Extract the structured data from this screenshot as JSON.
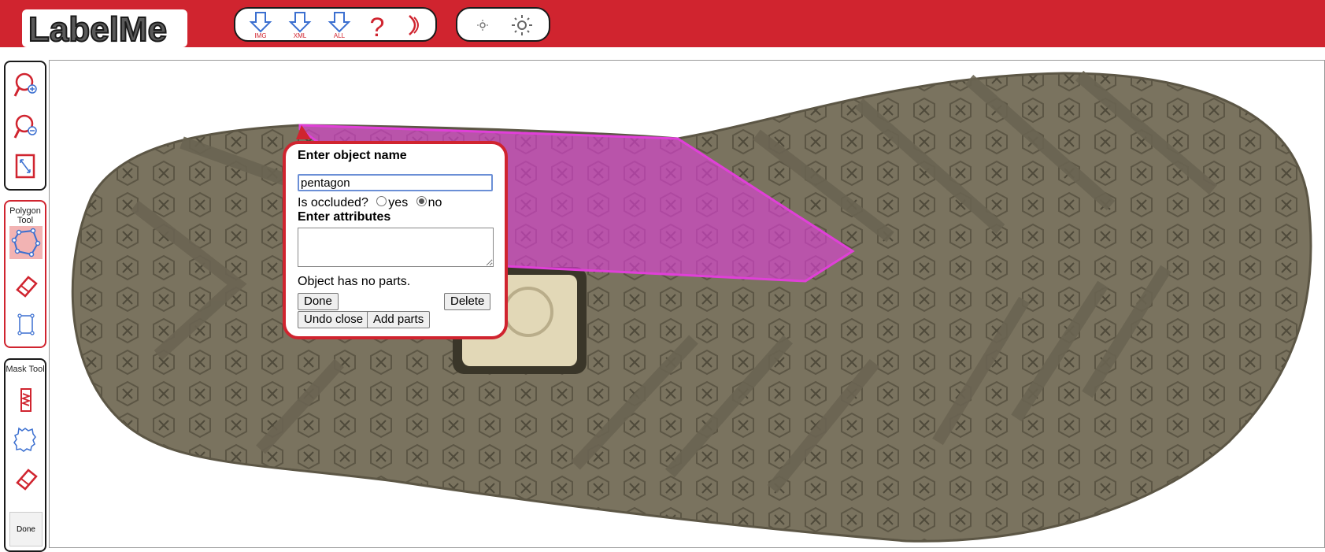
{
  "header": {
    "logo_text": "LabelMe",
    "toolbar": [
      {
        "icon": "download-image-icon",
        "label": "IMG"
      },
      {
        "icon": "download-xml-icon",
        "label": "XML"
      },
      {
        "icon": "download-all-icon",
        "label": "ALL"
      },
      {
        "icon": "help-icon",
        "label": "?"
      },
      {
        "icon": "moon-icon",
        "label": ""
      }
    ],
    "brightness": [
      {
        "icon": "brightness-low-icon"
      },
      {
        "icon": "brightness-high-icon"
      }
    ]
  },
  "sidebar": {
    "zoom": [
      "zoom-in-icon",
      "zoom-out-icon",
      "fit-to-screen-icon"
    ],
    "polygon_tool": {
      "title": "Polygon Tool"
    },
    "mask_tool": {
      "title": "Mask Tool",
      "done_label": "Done"
    }
  },
  "popup": {
    "title": "Enter object name",
    "name_value": "pentagon",
    "occluded_label": "Is occluded?",
    "yes_label": "yes",
    "no_label": "no",
    "occluded_selected": "no",
    "attributes_title": "Enter attributes",
    "attributes_value": "",
    "parts_status": "Object has no parts.",
    "done_label": "Done",
    "delete_label": "Delete",
    "undo_label": "Undo close",
    "add_parts_label": "Add parts"
  },
  "colors": {
    "header_red": "#d0242f",
    "polygon_fill": "#e040d8",
    "sole": "#7a735f"
  }
}
